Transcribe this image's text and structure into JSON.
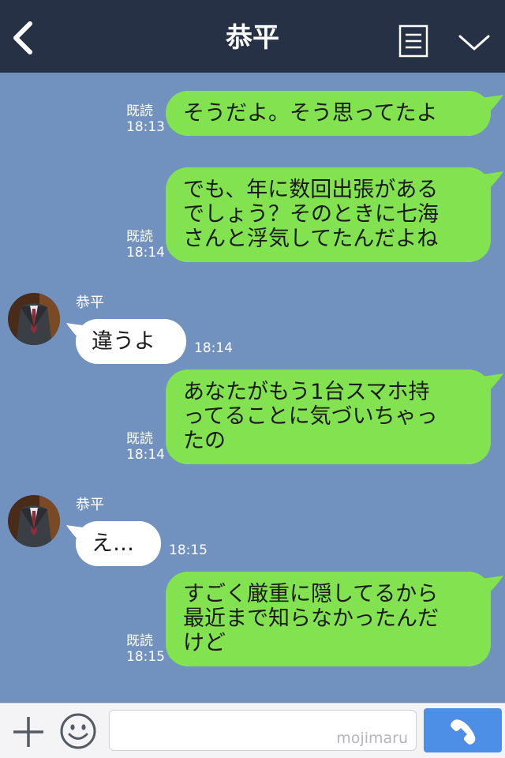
{
  "header": {
    "title": "恭平",
    "back_icon": "chevron-left-icon",
    "menu_icon": "menu-list-icon",
    "collapse_icon": "chevron-down-icon",
    "background_color": "#263146"
  },
  "chat": {
    "background_color": "#7192bf",
    "outgoing_bubble_color": "#83e24f",
    "incoming_bubble_color": "#ffffff",
    "messages": [
      {
        "direction": "outgoing",
        "text": "そうだよ。そう思ってたよ",
        "read_label": "既読",
        "time": "18:13"
      },
      {
        "direction": "outgoing",
        "text": "でも、年に数回出張がある\nでしょう？そのときに七海\nさんと浮気してたんだよね",
        "read_label": "既読",
        "time": "18:14"
      },
      {
        "direction": "incoming",
        "sender": "恭平",
        "text": "違うよ",
        "time": "18:14"
      },
      {
        "direction": "outgoing",
        "text": "あなたがもう1台スマホ持\nってることに気づいちゃっ\nたの",
        "read_label": "既読",
        "time": "18:14"
      },
      {
        "direction": "incoming",
        "sender": "恭平",
        "text": "え…",
        "time": "18:15"
      },
      {
        "direction": "outgoing",
        "text": "すごく厳重に隠してるから\n最近まで知らなかったんだ\nけど",
        "read_label": "既読",
        "time": "18:15"
      }
    ]
  },
  "footer": {
    "plus_icon": "plus-icon",
    "emoji_icon": "smiley-icon",
    "input_value": "",
    "watermark": "mojimaru",
    "call_icon": "phone-icon",
    "call_button_color": "#4d8ee6"
  }
}
